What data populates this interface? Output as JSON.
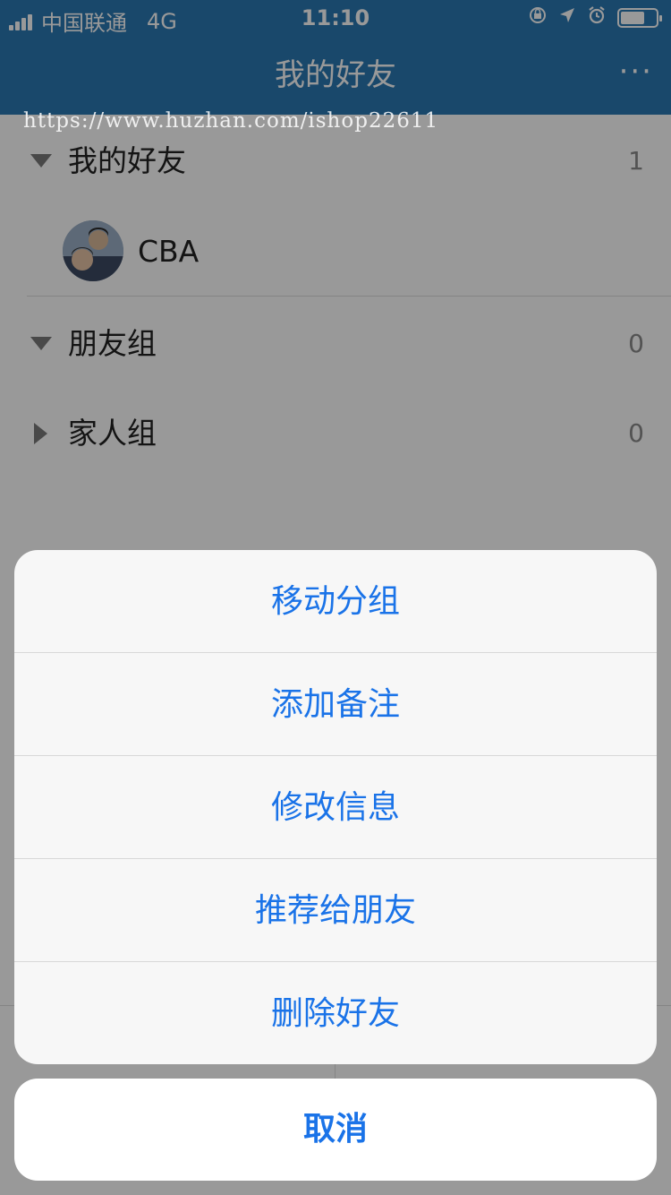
{
  "status_bar": {
    "carrier": "中国联通",
    "network": "4G",
    "time": "11:10",
    "icons": [
      "orientation-lock-icon",
      "location-arrow-icon",
      "alarm-icon",
      "battery-icon"
    ]
  },
  "nav": {
    "title": "我的好友",
    "more_label": "···"
  },
  "watermark": "https://www.huzhan.com/ishop22611",
  "groups": [
    {
      "name": "我的好友",
      "count": "1",
      "expanded": true,
      "friends": [
        {
          "name": "CBA"
        }
      ]
    },
    {
      "name": "朋友组",
      "count": "0",
      "expanded": true,
      "friends": []
    },
    {
      "name": "家人组",
      "count": "0",
      "expanded": false,
      "friends": []
    }
  ],
  "action_sheet": {
    "items": [
      "移动分组",
      "添加备注",
      "修改信息",
      "推荐给朋友",
      "删除好友"
    ],
    "cancel": "取消"
  },
  "colors": {
    "header": "#2a78b3",
    "action_text": "#1a73e8",
    "overlay": "rgba(0,0,0,0.4)"
  }
}
